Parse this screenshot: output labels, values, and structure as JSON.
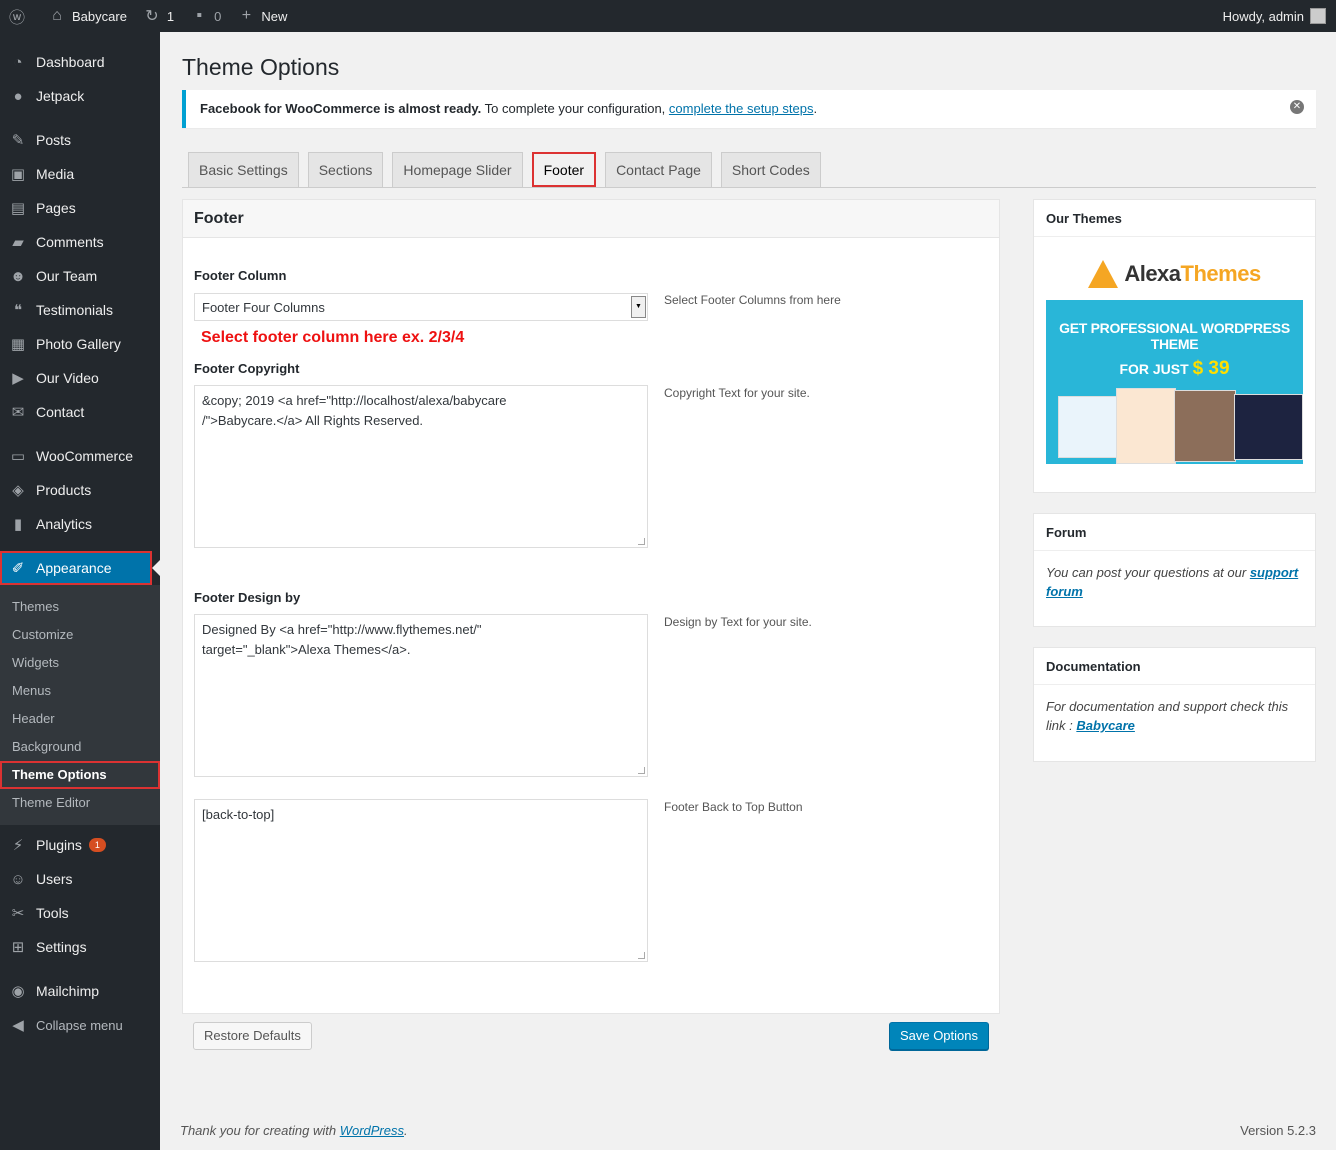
{
  "adminbar": {
    "site_name": "Babycare",
    "updates_count": "1",
    "comments_count": "0",
    "new_label": "New",
    "howdy": "Howdy, admin"
  },
  "sidebar": {
    "items": [
      {
        "label": "Dashboard",
        "icon": "dashboard-icon"
      },
      {
        "label": "Jetpack",
        "icon": "jetpack-icon"
      },
      {
        "label": "Posts",
        "icon": "pin-icon"
      },
      {
        "label": "Media",
        "icon": "media-icon"
      },
      {
        "label": "Pages",
        "icon": "pages-icon"
      },
      {
        "label": "Comments",
        "icon": "comments-icon"
      },
      {
        "label": "Our Team",
        "icon": "team-icon"
      },
      {
        "label": "Testimonials",
        "icon": "quote-icon"
      },
      {
        "label": "Photo Gallery",
        "icon": "gallery-icon"
      },
      {
        "label": "Our Video",
        "icon": "video-icon"
      },
      {
        "label": "Contact",
        "icon": "mail-icon"
      },
      {
        "label": "WooCommerce",
        "icon": "woo-icon"
      },
      {
        "label": "Products",
        "icon": "box-icon"
      },
      {
        "label": "Analytics",
        "icon": "chart-icon"
      },
      {
        "label": "Appearance",
        "icon": "brush-icon"
      }
    ],
    "submenu": [
      "Themes",
      "Customize",
      "Widgets",
      "Menus",
      "Header",
      "Background",
      "Theme Options",
      "Theme Editor"
    ],
    "bottom_items": [
      {
        "label": "Plugins",
        "icon": "plugin-icon",
        "badge": "1"
      },
      {
        "label": "Users",
        "icon": "user-icon"
      },
      {
        "label": "Tools",
        "icon": "wrench-icon"
      },
      {
        "label": "Settings",
        "icon": "settings-icon"
      },
      {
        "label": "Mailchimp",
        "icon": "mailchimp-icon"
      },
      {
        "label": "Collapse menu",
        "icon": "collapse-icon"
      }
    ]
  },
  "page": {
    "title": "Theme Options",
    "notice_bold": "Facebook for WooCommerce is almost ready.",
    "notice_text": " To complete your configuration, ",
    "notice_link": "complete the setup steps",
    "notice_end": "."
  },
  "tabs": [
    "Basic Settings",
    "Sections",
    "Homepage Slider",
    "Footer",
    "Contact Page",
    "Short Codes"
  ],
  "footer_panel": {
    "heading": "Footer",
    "column_label": "Footer Column",
    "column_value": "Footer Four Columns",
    "column_help": "Select Footer Columns from here",
    "red_note": "Select footer column here ex. 2/3/4",
    "copyright_label": "Footer Copyright",
    "copyright_value": "&copy; 2019 <a href=\"http://localhost/alexa/babycare\n/\">Babycare.</a> All Rights Reserved.",
    "copyright_help": "Copyright Text for your site.",
    "design_label": "Footer Design by",
    "design_value": "Designed By <a href=\"http://www.flythemes.net/\"\ntarget=\"_blank\">Alexa Themes</a>.",
    "design_help": "Design by Text for your site.",
    "backtop_value": "[back-to-top]",
    "backtop_help": "Footer Back to Top Button"
  },
  "buttons": {
    "restore": "Restore Defaults",
    "save": "Save Options"
  },
  "side": {
    "themes_title": "Our Themes",
    "logo_part1": "Alexa",
    "logo_part2": "Themes",
    "banner_line1": "GET PROFESSIONAL WORDPRESS THEME",
    "banner_line2": "FOR JUST",
    "banner_price": "$ 39",
    "forum_title": "Forum",
    "forum_text": "You can post your questions at our ",
    "forum_link1": "support",
    "forum_link2": "forum",
    "docs_title": "Documentation",
    "docs_text": "For documentation and support check this link : ",
    "docs_link": "Babycare"
  },
  "wp_footer": {
    "thanks": "Thank you for creating with ",
    "wp_link": "WordPress",
    "thanks_end": ".",
    "version": "Version 5.2.3"
  },
  "colors": {
    "accent": "#0073aa",
    "highlight": "#dc3232",
    "sidebar_bg": "#23282d"
  }
}
